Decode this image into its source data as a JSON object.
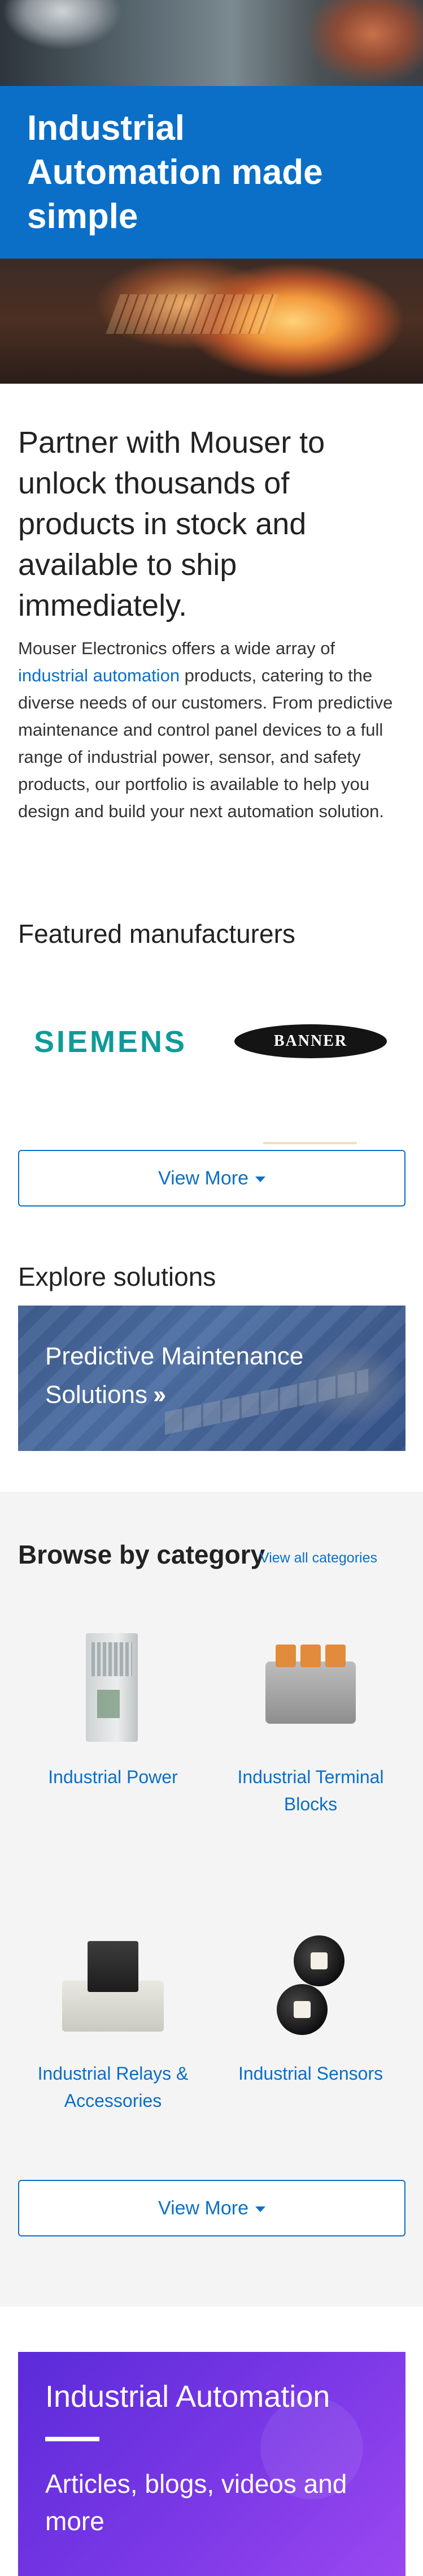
{
  "hero": {
    "title": "Industrial Automation made simple"
  },
  "intro": {
    "heading": "Partner with Mouser to unlock thousands of products in stock and available to ship immediately.",
    "body_before_link": "Mouser Electronics offers a wide array of ",
    "link_text": "industrial automation",
    "body_after_link": " products, catering to the diverse needs of our customers. From predictive maintenance and control panel devices to a full range of industrial power, sensor, and safety products, our portfolio is available to help you design and build your next automation solution."
  },
  "manufacturers": {
    "heading": "Featured manufacturers",
    "logos": [
      "SIEMENS",
      "BANNER"
    ],
    "view_more_label": "View More"
  },
  "explore": {
    "heading": "Explore solutions",
    "card_label": "Predictive Maintenance Solutions",
    "card_icon": "double-chevron-right-icon"
  },
  "browse": {
    "heading": "Browse by category",
    "view_all_label": "View all categories",
    "categories": [
      {
        "label": "Industrial Power",
        "icon": "power-supply-image"
      },
      {
        "label": "Industrial Terminal Blocks",
        "icon": "terminal-block-image"
      },
      {
        "label": "Industrial Relays & Accessories",
        "icon": "relay-image"
      },
      {
        "label": "Industrial Sensors",
        "icon": "sensor-image"
      }
    ],
    "view_more_label": "View More"
  },
  "promo": {
    "title": "Industrial Automation",
    "subtitle": "Articles, blogs, videos and more"
  },
  "colors": {
    "accent_blue": "#0b6fc7",
    "siemens_teal": "#0f9b98",
    "promo_purple": "#7b38e6",
    "browse_bg": "#f4f4f4"
  }
}
